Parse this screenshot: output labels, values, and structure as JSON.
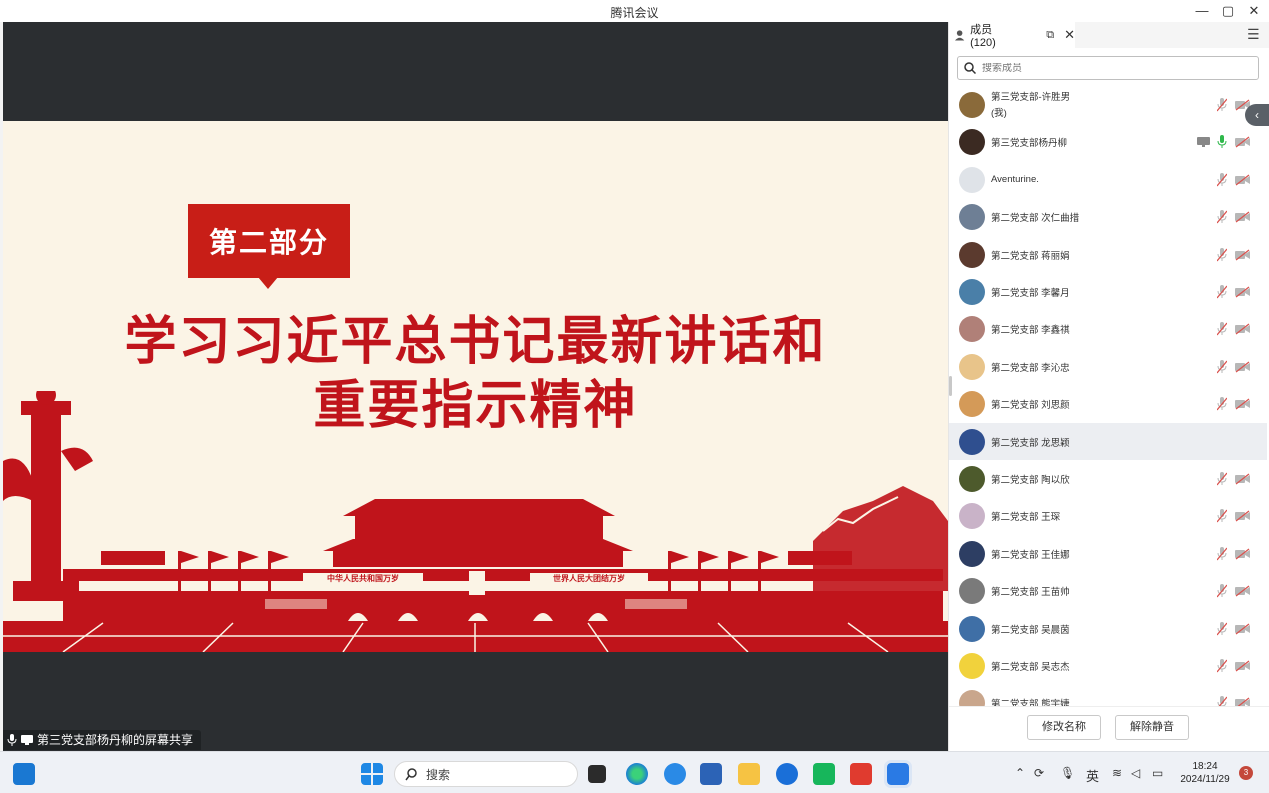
{
  "window": {
    "title": "腾讯会议"
  },
  "slide": {
    "section_label": "第二部分",
    "headline_line1": "学习习近平总书记最新讲话和",
    "headline_line2": "重要指示精神",
    "banner_left": "中华人民共和国万岁",
    "banner_right": "世界人民大团结万岁",
    "colors": {
      "red": "#c0141b",
      "background": "#fbf4e6"
    }
  },
  "share_badge": {
    "text": "第三党支部杨丹柳的屏幕共享",
    "icons": [
      "mic-icon",
      "screen-share-icon"
    ]
  },
  "panel": {
    "tab_label": "成员(120)",
    "search_placeholder": "搜索成员",
    "members": [
      {
        "name": "第三党支部-许胜男",
        "sub": "(我)",
        "avatar_color": "#8a6a3a",
        "mic": "muted",
        "cam": "off"
      },
      {
        "name": "第三党支部杨丹柳",
        "avatar_color": "#3b2a22",
        "mic": "active",
        "cam": "off",
        "sharing": true
      },
      {
        "name": "Aventurine.",
        "avatar_color": "#dfe3e8",
        "mic": "muted",
        "cam": "off"
      },
      {
        "name": "第二党支部 次仁曲措",
        "avatar_color": "#6e7f95",
        "mic": "muted",
        "cam": "off"
      },
      {
        "name": "第二党支部 蒋丽娟",
        "avatar_color": "#5b3a2e",
        "mic": "muted",
        "cam": "off"
      },
      {
        "name": "第二党支部 李馨月",
        "avatar_color": "#4a7fa8",
        "mic": "muted",
        "cam": "off"
      },
      {
        "name": "第二党支部 李鑫祺",
        "avatar_color": "#b08078",
        "mic": "muted",
        "cam": "off"
      },
      {
        "name": "第二党支部 李沁忠",
        "avatar_color": "#e8c48a",
        "mic": "muted",
        "cam": "off"
      },
      {
        "name": "第二党支部 刘思颜",
        "avatar_color": "#d49a58",
        "mic": "muted",
        "cam": "off"
      },
      {
        "name": "第二党支部 龙思颖",
        "avatar_color": "#2f4f8f",
        "mic": "none",
        "cam": "none",
        "highlight": true
      },
      {
        "name": "第二党支部 陶以欣",
        "avatar_color": "#4d5a2c",
        "mic": "muted",
        "cam": "off"
      },
      {
        "name": "第二党支部 王琛",
        "avatar_color": "#c9b3c8",
        "mic": "muted",
        "cam": "off"
      },
      {
        "name": "第二党支部 王佳娜",
        "avatar_color": "#2d3e63",
        "mic": "muted",
        "cam": "off"
      },
      {
        "name": "第二党支部 王苗帅",
        "avatar_color": "#7a7a7a",
        "mic": "muted",
        "cam": "off"
      },
      {
        "name": "第二党支部 吴晨茵",
        "avatar_color": "#3f6fa6",
        "mic": "muted",
        "cam": "off"
      },
      {
        "name": "第二党支部 吴志杰",
        "avatar_color": "#f1d23c",
        "mic": "muted",
        "cam": "off"
      },
      {
        "name": "第二党支部 熊宇婕",
        "avatar_color": "#c9a68c",
        "mic": "muted",
        "cam": "off"
      }
    ],
    "footer": {
      "rename_label": "修改名称",
      "unmute_label": "解除静音"
    }
  },
  "taskbar": {
    "search_label": "搜索",
    "ime_label": "英",
    "time": "18:24",
    "date": "2024/11/29",
    "notification_count": "3",
    "apps": [
      "windows-start-icon",
      "task-view-icon",
      "edge-icon",
      "edge-legacy-icon",
      "store-icon",
      "file-explorer-icon",
      "browser-icon",
      "wechat-icon",
      "wps-icon",
      "tencent-meeting-icon"
    ]
  }
}
